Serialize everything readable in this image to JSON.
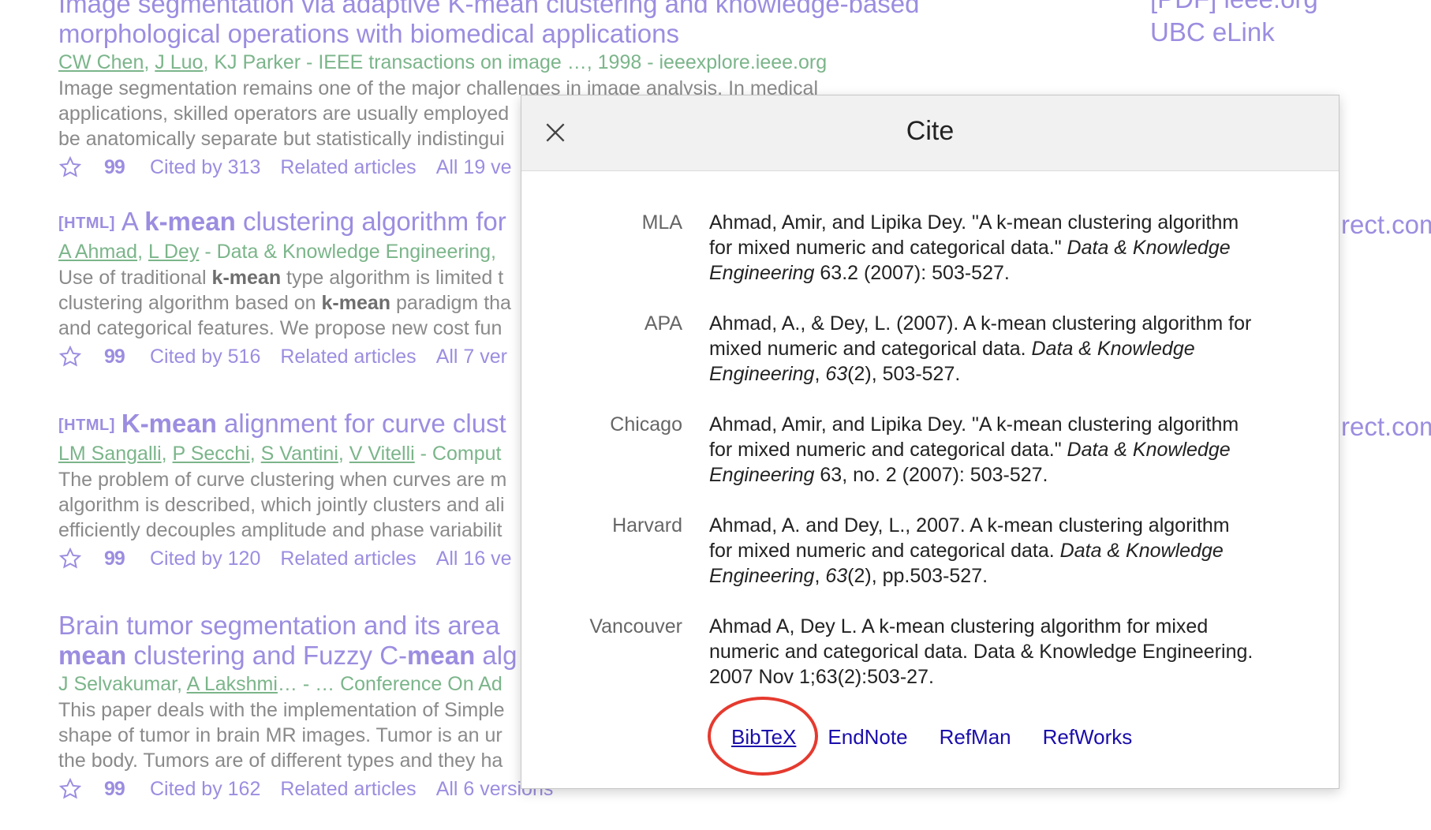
{
  "side_links": {
    "pdf_top": "[PDF] ieee.org",
    "ubc_elink": "UBC eLink",
    "direct_1": "rect.com",
    "direct_2": "rect.com"
  },
  "results": [
    {
      "title_line1": "Image segmentation via adaptive K-mean clustering and knowledge-based",
      "title_line2": "morphological operations with biomedical applications",
      "authors": [
        "CW Chen",
        "J Luo"
      ],
      "authors_rest": ", KJ Parker - IEEE transactions on image …, 1998 - ieeexplore.ieee.org",
      "snippet": [
        "Image segmentation remains one of the major challenges in image analysis. In medical",
        "applications, skilled operators are usually employed",
        "be anatomically separate but statistically indistingui"
      ],
      "cited_by": "Cited by 313",
      "related": "Related articles",
      "versions": "All 19 ve"
    },
    {
      "tag": "[HTML]",
      "title_pre": "A ",
      "title_bold": "k-mean",
      "title_post": " clustering algorithm for",
      "authors": [
        "A Ahmad",
        "L Dey"
      ],
      "authors_rest": " - Data & Knowledge Engineering, ",
      "snippet_html": [
        [
          "Use of traditional ",
          "k-mean",
          " type algorithm is limited t"
        ],
        [
          "clustering algorithm based on ",
          "k-mean",
          " paradigm tha"
        ],
        [
          "and categorical features. We propose new cost fun",
          "",
          ""
        ]
      ],
      "cited_by": "Cited by 516",
      "related": "Related articles",
      "versions": "All 7 ver"
    },
    {
      "tag": "[HTML]",
      "title_bold": "K-mean",
      "title_post": " alignment for curve clust",
      "authors": [
        "LM Sangalli",
        "P Secchi",
        "S Vantini",
        "V Vitelli"
      ],
      "authors_rest": " - Comput",
      "snippet": [
        "The problem of curve clustering when curves are m",
        "algorithm is described, which jointly clusters and ali",
        "efficiently decouples amplitude and phase variabilit"
      ],
      "cited_by": "Cited by 120",
      "related": "Related articles",
      "versions": "All 16 ve"
    },
    {
      "title_line1": "Brain tumor segmentation and its area",
      "title_line2_bold": "mean",
      "title_line2_mid": " clustering and Fuzzy C-",
      "title_line2_bold2": "mean",
      "title_line2_post": " alg",
      "authors_first": "J Selvakumar, ",
      "authors": [
        "A Lakshmi"
      ],
      "authors_rest": "… - … Conference On Ad",
      "snippet": [
        "This paper deals with the implementation of Simple",
        "shape of tumor in brain MR images. Tumor is an ur",
        "the body. Tumors are of different types and they ha"
      ],
      "cited_by": "Cited by 162",
      "related": "Related articles",
      "versions": "All 6 versions"
    }
  ],
  "dialog": {
    "title": "Cite",
    "citations": [
      {
        "style": "MLA",
        "l1": "Ahmad, Amir, and Lipika Dey. \"A k-mean clustering algorithm",
        "l2a": "for mixed numeric and categorical data.\" ",
        "l2i": "Data & Knowledge",
        "l3i": "Engineering",
        "l3b": " 63.2 (2007): 503-527."
      },
      {
        "style": "APA",
        "l1": "Ahmad, A., & Dey, L. (2007). A k-mean clustering algorithm for",
        "l2a": "mixed numeric and categorical data. ",
        "l2i": "Data & Knowledge",
        "l3i": "Engineering",
        "l3b": ", ",
        "l3i2": "63",
        "l3c": "(2), 503-527."
      },
      {
        "style": "Chicago",
        "l1": "Ahmad, Amir, and Lipika Dey. \"A k-mean clustering algorithm",
        "l2a": "for mixed numeric and categorical data.\" ",
        "l2i": "Data & Knowledge",
        "l3i": "Engineering",
        "l3b": " 63, no. 2 (2007): 503-527."
      },
      {
        "style": "Harvard",
        "l1": "Ahmad, A. and Dey, L., 2007. A k-mean clustering algorithm",
        "l2a": "for mixed numeric and categorical data. ",
        "l2i": "Data & Knowledge",
        "l3i": "Engineering",
        "l3b": ", ",
        "l3i2": "63",
        "l3c": "(2), pp.503-527."
      },
      {
        "style": "Vancouver",
        "l1": "Ahmad A, Dey L. A k-mean clustering algorithm for mixed",
        "l2a": "numeric and categorical data. Data & Knowledge Engineering.",
        "l3b": "2007 Nov 1;63(2):503-27."
      }
    ],
    "export_links": [
      "BibTeX",
      "EndNote",
      "RefMan",
      "RefWorks"
    ]
  },
  "colors": {
    "result_title": "#9c8de0",
    "authors": "#7bb58a",
    "link_blue": "#1a0dab",
    "highlight": "#e53a2f"
  }
}
